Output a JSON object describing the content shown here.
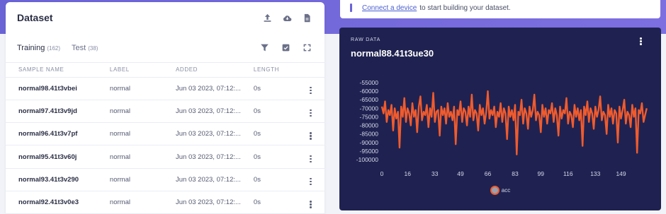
{
  "dataset": {
    "title": "Dataset",
    "header_icons": [
      "upload-icon",
      "cloud-icon",
      "file-icon"
    ],
    "tabs": [
      {
        "label": "Training",
        "count": "(162)",
        "active": true
      },
      {
        "label": "Test",
        "count": "(38)",
        "active": false
      }
    ],
    "tab_icons": [
      "filter-icon",
      "checkbox-icon",
      "expand-icon"
    ],
    "columns": [
      "SAMPLE NAME",
      "LABEL",
      "ADDED",
      "LENGTH"
    ],
    "rows": [
      {
        "name": "normal98.41t3vbei",
        "label": "normal",
        "added": "Jun 03 2023, 07:12:...",
        "length": "0s"
      },
      {
        "name": "normal97.41t3v9jd",
        "label": "normal",
        "added": "Jun 03 2023, 07:12:...",
        "length": "0s"
      },
      {
        "name": "normal96.41t3v7pf",
        "label": "normal",
        "added": "Jun 03 2023, 07:12:...",
        "length": "0s"
      },
      {
        "name": "normal95.41t3v60j",
        "label": "normal",
        "added": "Jun 03 2023, 07:12:...",
        "length": "0s"
      },
      {
        "name": "normal93.41t3v290",
        "label": "normal",
        "added": "Jun 03 2023, 07:12:...",
        "length": "0s"
      },
      {
        "name": "normal92.41t3v0e3",
        "label": "normal",
        "added": "Jun 03 2023, 07:12:...",
        "length": "0s"
      }
    ]
  },
  "banner": {
    "link": "Connect a device",
    "text": "to start building your dataset."
  },
  "raw_data": {
    "label": "RAW DATA",
    "title": "normal88.41t3ue30",
    "legend": "acc",
    "line_color": "#ef5b2e"
  },
  "chart_data": {
    "type": "line",
    "x_ticks": [
      "0",
      "16",
      "33",
      "49",
      "66",
      "83",
      "99",
      "116",
      "133",
      "149"
    ],
    "y_ticks": [
      "-55000",
      "-60000",
      "-65000",
      "-70000",
      "-75000",
      "-80000",
      "-85000",
      "-90000",
      "-95000",
      "-100000"
    ],
    "xlim": [
      0,
      162
    ],
    "ylim": [
      -100000,
      -55000
    ],
    "grid": false,
    "legend_position": "bottom",
    "series": [
      {
        "name": "acc",
        "values": [
          -69000,
          -73000,
          -66000,
          -78000,
          -71000,
          -74000,
          -68000,
          -83000,
          -70000,
          -76000,
          -72000,
          -93000,
          -69000,
          -75000,
          -64000,
          -78000,
          -70000,
          -73000,
          -80000,
          -67000,
          -75000,
          -71000,
          -84000,
          -69000,
          -63000,
          -77000,
          -72000,
          -74000,
          -68000,
          -81000,
          -70000,
          -75000,
          -61000,
          -78000,
          -72000,
          -71000,
          -86000,
          -69000,
          -74000,
          -70000,
          -79000,
          -67000,
          -75000,
          -72000,
          -77000,
          -69000,
          -91000,
          -71000,
          -74000,
          -66000,
          -78000,
          -70000,
          -72000,
          -80000,
          -69000,
          -75000,
          -62000,
          -77000,
          -71000,
          -73000,
          -83000,
          -68000,
          -74000,
          -70000,
          -79000,
          -72000,
          -60000,
          -76000,
          -71000,
          -74000,
          -69000,
          -81000,
          -72000,
          -75000,
          -67000,
          -78000,
          -70000,
          -73000,
          -88000,
          -69000,
          -75000,
          -71000,
          -77000,
          -68000,
          -97000,
          -72000,
          -74000,
          -65000,
          -79000,
          -70000,
          -73000,
          -82000,
          -69000,
          -75000,
          -71000,
          -62000,
          -77000,
          -72000,
          -74000,
          -84000,
          -68000,
          -75000,
          -70000,
          -79000,
          -71000,
          -73000,
          -67000,
          -78000,
          -70000,
          -74000,
          -86000,
          -69000,
          -76000,
          -71000,
          -73000,
          -64000,
          -79000,
          -72000,
          -74000,
          -81000,
          -68000,
          -75000,
          -70000,
          -77000,
          -71000,
          -92000,
          -69000,
          -74000,
          -66000,
          -78000,
          -70000,
          -73000,
          -82000,
          -69000,
          -75000,
          -71000,
          -63000,
          -77000,
          -72000,
          -74000,
          -85000,
          -68000,
          -75000,
          -70000,
          -79000,
          -71000,
          -73000,
          -90000,
          -69000,
          -76000,
          -71000,
          -65000,
          -79000,
          -72000,
          -74000,
          -81000,
          -68000,
          -75000,
          -70000,
          -96000,
          -71000,
          -73000,
          -67000,
          -78000,
          -74000,
          -70000
        ]
      }
    ]
  }
}
